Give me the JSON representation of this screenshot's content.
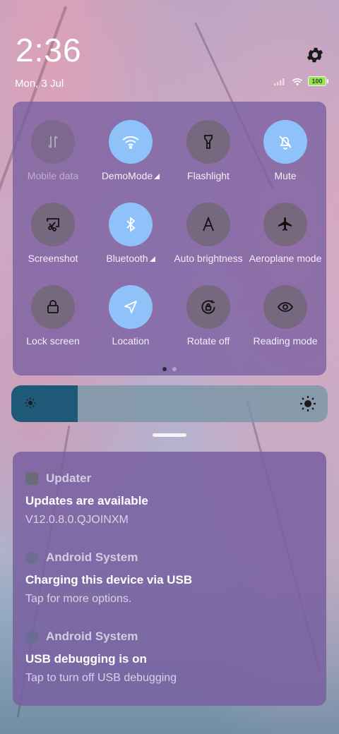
{
  "status_bar": {
    "time": "2:36",
    "date": "Mon, 3 Jul",
    "battery": "100"
  },
  "quick_tiles": [
    {
      "label": "Mobile data",
      "icon": "mobile-data-icon",
      "state": "disabled"
    },
    {
      "label": "DemoMode",
      "icon": "wifi-icon",
      "state": "active",
      "expandable": true
    },
    {
      "label": "Flashlight",
      "icon": "flashlight-icon",
      "state": "inactive"
    },
    {
      "label": "Mute",
      "icon": "bell-off-icon",
      "state": "active"
    },
    {
      "label": "Screenshot",
      "icon": "screenshot-icon",
      "state": "inactive"
    },
    {
      "label": "Bluetooth",
      "icon": "bluetooth-icon",
      "state": "active",
      "expandable": true
    },
    {
      "label": "Auto brightness",
      "icon": "auto-brightness-icon",
      "state": "inactive"
    },
    {
      "label": "Aeroplane mode",
      "icon": "airplane-icon",
      "state": "inactive"
    },
    {
      "label": "Lock screen",
      "icon": "lock-icon",
      "state": "inactive"
    },
    {
      "label": "Location",
      "icon": "location-arrow-icon",
      "state": "active"
    },
    {
      "label": "Rotate off",
      "icon": "rotate-lock-icon",
      "state": "inactive"
    },
    {
      "label": "Reading mode",
      "icon": "eye-icon",
      "state": "inactive"
    }
  ],
  "page_indicator": {
    "pages": 2,
    "current": 1
  },
  "brightness": {
    "level": 0.21
  },
  "notifications": [
    {
      "app": "Updater",
      "title": "Updates are available",
      "text": "V12.0.8.0.QJOINXM"
    },
    {
      "app": "Android System",
      "title": "Charging this device via USB",
      "text": "Tap for more options."
    },
    {
      "app": "Android System",
      "title": "USB debugging is on",
      "text": "Tap to turn off USB debugging"
    }
  ],
  "colors": {
    "active_tile": "#8ec2f9",
    "panel": "#785fa0",
    "brightness_fill": "#1e5a78"
  }
}
